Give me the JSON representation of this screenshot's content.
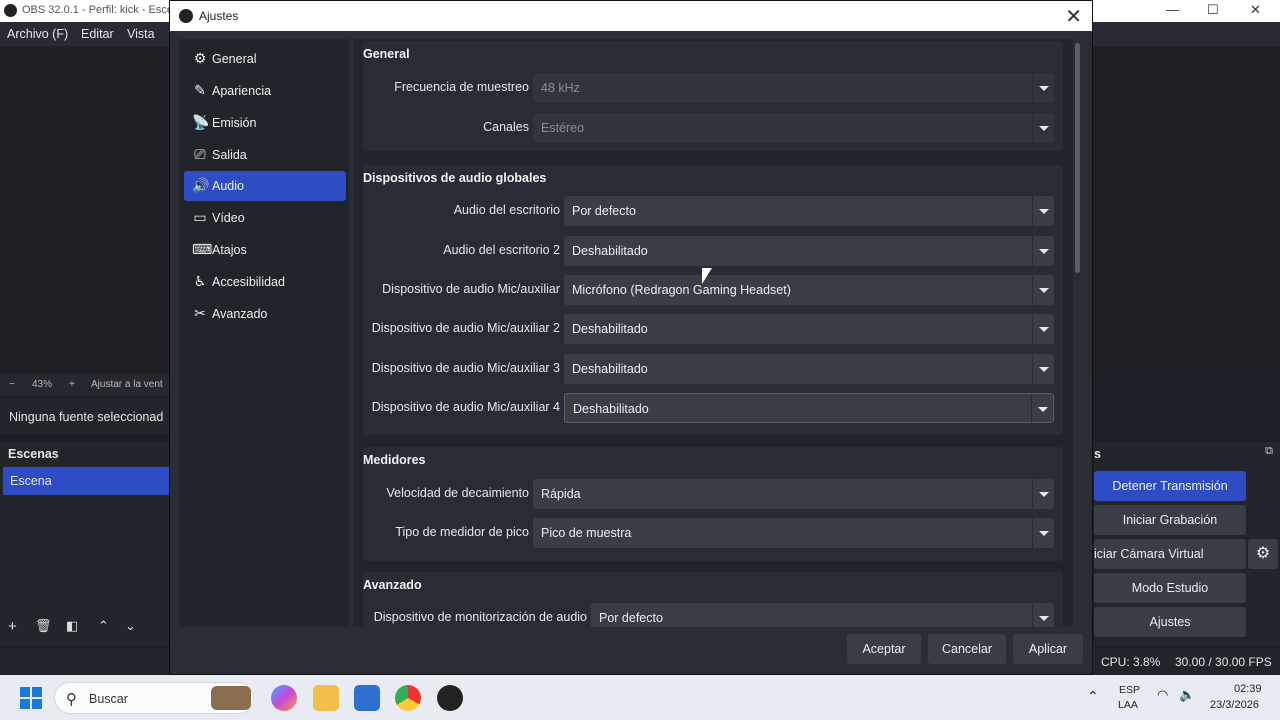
{
  "obs": {
    "title": "OBS 32.0.1 - Perfil: kick - Esce",
    "menu": [
      "Archivo (F)",
      "Editar",
      "Vista"
    ],
    "zoom": {
      "minus": "−",
      "value": "43%",
      "plus": "+",
      "fit": "Ajustar a la vent"
    },
    "no_source": "Ninguna fuente seleccionad",
    "scenes_title": "Escenas",
    "scene_item": "Escena",
    "controls_title": "s",
    "controls": [
      "Detener Transmisión",
      "Iniciar Grabación",
      "iciar Cámara Virtual",
      "Modo Estudio",
      "Ajustes"
    ],
    "status": {
      "cpu": "CPU: 3.8%",
      "fps": "30.00 / 30.00 FPS"
    }
  },
  "dialog": {
    "title": "Ajustes",
    "nav": [
      {
        "label": "General",
        "icon": "gear-icon"
      },
      {
        "label": "Apariencia",
        "icon": "appearance-icon"
      },
      {
        "label": "Emisión",
        "icon": "antenna-icon"
      },
      {
        "label": "Salida",
        "icon": "output-icon"
      },
      {
        "label": "Audio",
        "icon": "speaker-icon"
      },
      {
        "label": "Vídeo",
        "icon": "monitor-icon"
      },
      {
        "label": "Atajos",
        "icon": "keyboard-icon"
      },
      {
        "label": "Accesibilidad",
        "icon": "accessibility-icon"
      },
      {
        "label": "Avanzado",
        "icon": "tools-icon"
      }
    ],
    "active_nav": "Audio",
    "sections": {
      "general": {
        "title": "General",
        "sample_rate": {
          "label": "Frecuencia de muestreo",
          "value": "48 kHz"
        },
        "channels": {
          "label": "Canales",
          "value": "Estéreo"
        }
      },
      "global_devices": {
        "title": "Dispositivos de audio globales",
        "desktop1": {
          "label": "Audio del escritorio",
          "value": "Por defecto"
        },
        "desktop2": {
          "label": "Audio del escritorio 2",
          "value": "Deshabilitado"
        },
        "mic1": {
          "label": "Dispositivo de audio Mic/auxiliar",
          "value": "Micrófono (Redragon Gaming Headset)"
        },
        "mic2": {
          "label": "Dispositivo de audio Mic/auxiliar 2",
          "value": "Deshabilitado"
        },
        "mic3": {
          "label": "Dispositivo de audio Mic/auxiliar 3",
          "value": "Deshabilitado"
        },
        "mic4": {
          "label": "Dispositivo de audio Mic/auxiliar 4",
          "value": "Deshabilitado"
        }
      },
      "meters": {
        "title": "Medidores",
        "decay": {
          "label": "Velocidad de decaimiento",
          "value": "Rápida"
        },
        "peak": {
          "label": "Tipo de medidor de pico",
          "value": "Pico de muestra"
        }
      },
      "advanced": {
        "title": "Avanzado",
        "monitor": {
          "label": "Dispositivo de monitorización de audio",
          "value": "Por defecto"
        }
      }
    },
    "buttons": {
      "ok": "Aceptar",
      "cancel": "Cancelar",
      "apply": "Aplicar"
    }
  },
  "taskbar": {
    "search_placeholder": "Buscar",
    "lang_top": "ESP",
    "lang_bottom": "LAA",
    "time": "02:39",
    "date": "23/3/2026"
  },
  "colors": {
    "accent": "#2e4cc4",
    "panel": "#22242b",
    "combo": "#3a3c46"
  }
}
